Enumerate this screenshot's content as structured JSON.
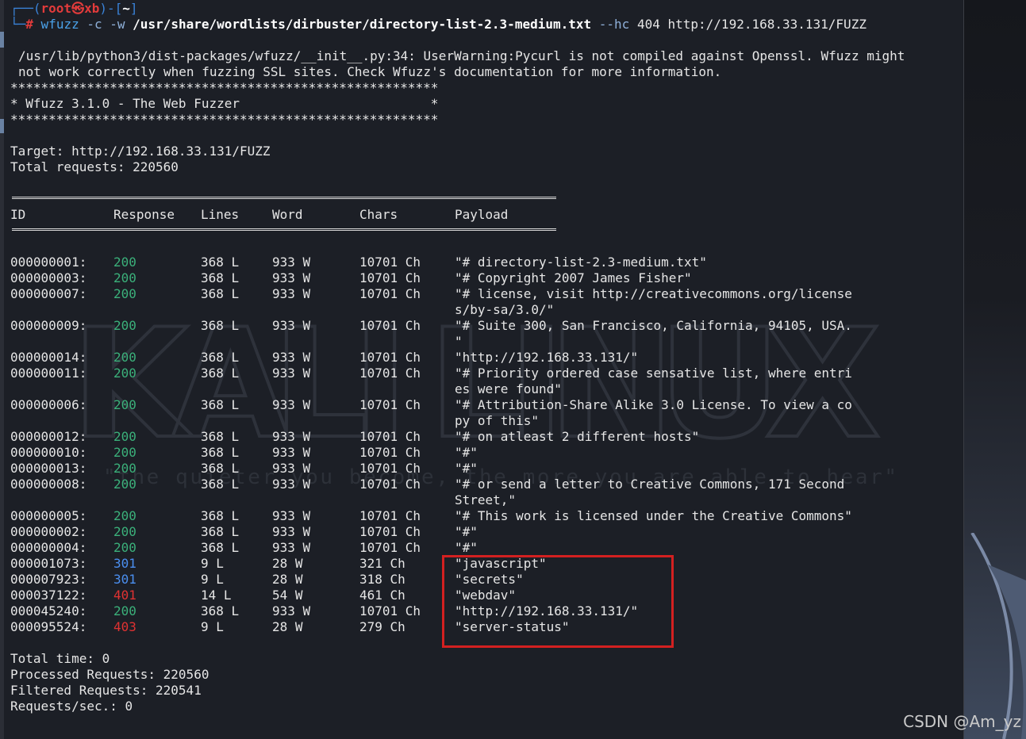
{
  "prompt": {
    "user": "root",
    "host": "xb",
    "cwd": "~",
    "command": "wfuzz",
    "flags1": "-c -w",
    "wordlist": "/usr/share/wordlists/dirbuster/directory-list-2.3-medium.txt",
    "flags2": "--hc",
    "hide_code": "404",
    "url": "http://192.168.33.131/FUZZ"
  },
  "warning": [
    "/usr/lib/python3/dist-packages/wfuzz/__init__.py:34: UserWarning:Pycurl is not compiled against Openssl. Wfuzz might",
    "not work correctly when fuzzing SSL sites. Check Wfuzz's documentation for more information."
  ],
  "banner": {
    "stars": "********************************************************",
    "title": "* Wfuzz 3.1.0 - The Web Fuzzer                         *"
  },
  "target": "Target: http://192.168.33.131/FUZZ",
  "total_requests": "Total requests: 220560",
  "headers": {
    "id": "ID",
    "response": "Response",
    "lines": "Lines",
    "word": "Word",
    "chars": "Chars",
    "payload": "Payload"
  },
  "rows": [
    {
      "id": "000000001:",
      "code": "200",
      "lines": "368 L",
      "word": "933 W",
      "chars": "10701 Ch",
      "payload": "\"# directory-list-2.3-medium.txt\"",
      "payload2": ""
    },
    {
      "id": "000000003:",
      "code": "200",
      "lines": "368 L",
      "word": "933 W",
      "chars": "10701 Ch",
      "payload": "\"# Copyright 2007 James Fisher\"",
      "payload2": ""
    },
    {
      "id": "000000007:",
      "code": "200",
      "lines": "368 L",
      "word": "933 W",
      "chars": "10701 Ch",
      "payload": "\"# license, visit http://creativecommons.org/license",
      "payload2": "s/by-sa/3.0/\""
    },
    {
      "id": "000000009:",
      "code": "200",
      "lines": "368 L",
      "word": "933 W",
      "chars": "10701 Ch",
      "payload": "\"# Suite 300, San Francisco, California, 94105, USA.",
      "payload2": "\""
    },
    {
      "id": "000000014:",
      "code": "200",
      "lines": "368 L",
      "word": "933 W",
      "chars": "10701 Ch",
      "payload": "\"http://192.168.33.131/\"",
      "payload2": ""
    },
    {
      "id": "000000011:",
      "code": "200",
      "lines": "368 L",
      "word": "933 W",
      "chars": "10701 Ch",
      "payload": "\"# Priority ordered case sensative list, where entri",
      "payload2": "es were found\""
    },
    {
      "id": "000000006:",
      "code": "200",
      "lines": "368 L",
      "word": "933 W",
      "chars": "10701 Ch",
      "payload": "\"# Attribution-Share Alike 3.0 License. To view a co",
      "payload2": "py of this\""
    },
    {
      "id": "000000012:",
      "code": "200",
      "lines": "368 L",
      "word": "933 W",
      "chars": "10701 Ch",
      "payload": "\"# on atleast 2 different hosts\"",
      "payload2": ""
    },
    {
      "id": "000000010:",
      "code": "200",
      "lines": "368 L",
      "word": "933 W",
      "chars": "10701 Ch",
      "payload": "\"#\"",
      "payload2": ""
    },
    {
      "id": "000000013:",
      "code": "200",
      "lines": "368 L",
      "word": "933 W",
      "chars": "10701 Ch",
      "payload": "\"#\"",
      "payload2": ""
    },
    {
      "id": "000000008:",
      "code": "200",
      "lines": "368 L",
      "word": "933 W",
      "chars": "10701 Ch",
      "payload": "\"# or send a letter to Creative Commons, 171 Second",
      "payload2": "Street,\""
    },
    {
      "id": "000000005:",
      "code": "200",
      "lines": "368 L",
      "word": "933 W",
      "chars": "10701 Ch",
      "payload": "\"# This work is licensed under the Creative Commons\"",
      "payload2": ""
    },
    {
      "id": "000000002:",
      "code": "200",
      "lines": "368 L",
      "word": "933 W",
      "chars": "10701 Ch",
      "payload": "\"#\"",
      "payload2": ""
    },
    {
      "id": "000000004:",
      "code": "200",
      "lines": "368 L",
      "word": "933 W",
      "chars": "10701 Ch",
      "payload": "\"#\"",
      "payload2": ""
    },
    {
      "id": "000001073:",
      "code": "301",
      "lines": "9 L",
      "word": "28 W",
      "chars": "321 Ch",
      "payload": "\"javascript\"",
      "payload2": ""
    },
    {
      "id": "000007923:",
      "code": "301",
      "lines": "9 L",
      "word": "28 W",
      "chars": "318 Ch",
      "payload": "\"secrets\"",
      "payload2": ""
    },
    {
      "id": "000037122:",
      "code": "401",
      "lines": "14 L",
      "word": "54 W",
      "chars": "461 Ch",
      "payload": "\"webdav\"",
      "payload2": ""
    },
    {
      "id": "000045240:",
      "code": "200",
      "lines": "368 L",
      "word": "933 W",
      "chars": "10701 Ch",
      "payload": "\"http://192.168.33.131/\"",
      "payload2": ""
    },
    {
      "id": "000095524:",
      "code": "403",
      "lines": "9 L",
      "word": "28 W",
      "chars": "279 Ch",
      "payload": "\"server-status\"",
      "payload2": ""
    }
  ],
  "summary": [
    "Total time: 0",
    "Processed Requests: 220560",
    "Filtered Requests: 220541",
    "Requests/sec.: 0"
  ],
  "watermark": {
    "big": "KALI LINUX",
    "tagline": "\"the quieter you become, the more you are able to hear\""
  },
  "footer": "CSDN @Am_yz",
  "colors": {
    "background": "#1c1f26",
    "code_200": "#3bb07a",
    "code_301": "#4b8ff0",
    "code_401": "#e03232",
    "code_403": "#e03232",
    "highlight_box": "#d32020"
  }
}
